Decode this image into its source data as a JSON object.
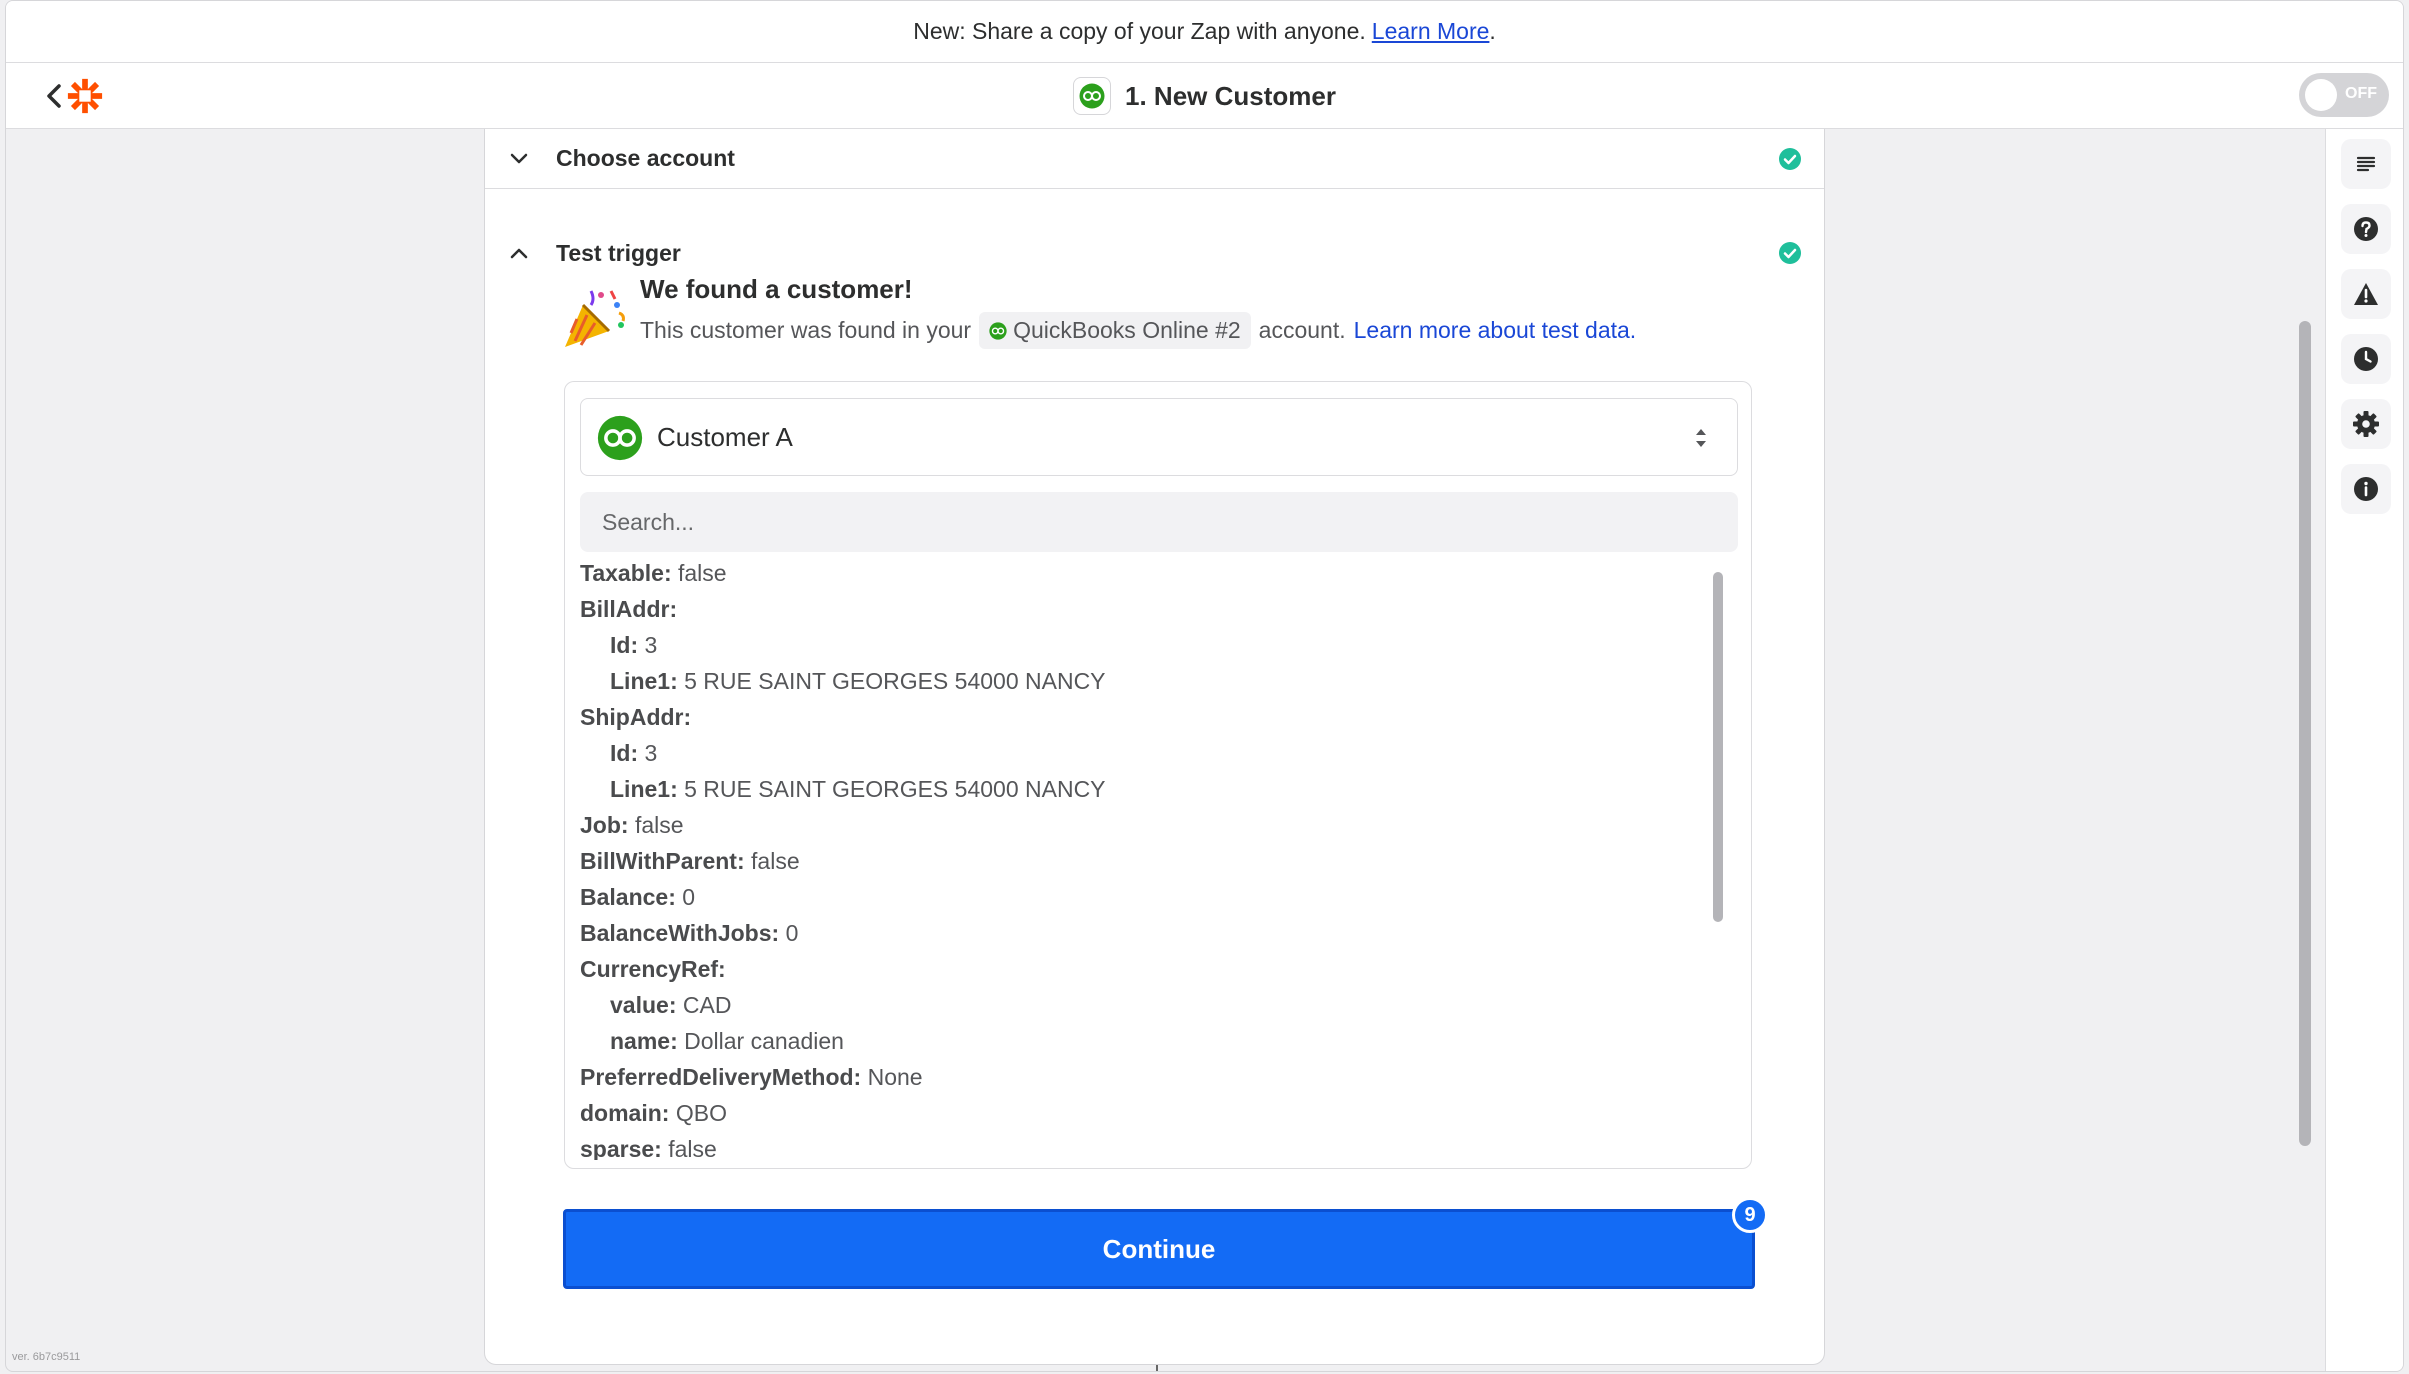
{
  "banner": {
    "text": "New: Share a copy of your Zap with anyone.",
    "link": "Learn More",
    "period": "."
  },
  "topbar": {
    "title": "1. New Customer",
    "toggle_label": "OFF"
  },
  "sections": {
    "choose_account": "Choose account",
    "test_trigger": "Test trigger"
  },
  "found": {
    "title": "We found a customer!",
    "sub_before": "This customer was found in your",
    "account_chip": "QuickBooks Online #2",
    "sub_after": "account.",
    "learn_link": "Learn more about test data."
  },
  "record": {
    "selected": "Customer A",
    "search_placeholder": "Search..."
  },
  "fields": [
    {
      "key": "Taxable:",
      "value": "false",
      "indent": false
    },
    {
      "key": "BillAddr:",
      "value": "",
      "indent": false
    },
    {
      "key": "Id:",
      "value": "3",
      "indent": true
    },
    {
      "key": "Line1:",
      "value": "5 RUE SAINT GEORGES 54000 NANCY",
      "indent": true
    },
    {
      "key": "ShipAddr:",
      "value": "",
      "indent": false
    },
    {
      "key": "Id:",
      "value": "3",
      "indent": true
    },
    {
      "key": "Line1:",
      "value": "5 RUE SAINT GEORGES 54000 NANCY",
      "indent": true
    },
    {
      "key": "Job:",
      "value": "false",
      "indent": false
    },
    {
      "key": "BillWithParent:",
      "value": "false",
      "indent": false
    },
    {
      "key": "Balance:",
      "value": "0",
      "indent": false
    },
    {
      "key": "BalanceWithJobs:",
      "value": "0",
      "indent": false
    },
    {
      "key": "CurrencyRef:",
      "value": "",
      "indent": false
    },
    {
      "key": "value:",
      "value": "CAD",
      "indent": true
    },
    {
      "key": "name:",
      "value": "Dollar canadien",
      "indent": true
    },
    {
      "key": "PreferredDeliveryMethod:",
      "value": "None",
      "indent": false
    },
    {
      "key": "domain:",
      "value": "QBO",
      "indent": false
    },
    {
      "key": "sparse:",
      "value": "false",
      "indent": false
    }
  ],
  "actions": {
    "continue_label": "Continue",
    "badge_count": "9"
  },
  "footer": {
    "version": "ver. 6b7c9511"
  },
  "colors": {
    "brand_orange": "#ff4f00",
    "quickbooks_green": "#2ca01c",
    "primary_blue": "#136bf5",
    "success_teal": "#1fbf9b",
    "link_blue": "#1a47d6"
  },
  "icons": {
    "back": "chevron-left-icon",
    "logo": "zapier-asterisk-logo",
    "app": "quickbooks-icon",
    "rail": [
      "list-icon",
      "help-icon",
      "warning-icon",
      "clock-icon",
      "gear-icon",
      "info-icon"
    ]
  }
}
